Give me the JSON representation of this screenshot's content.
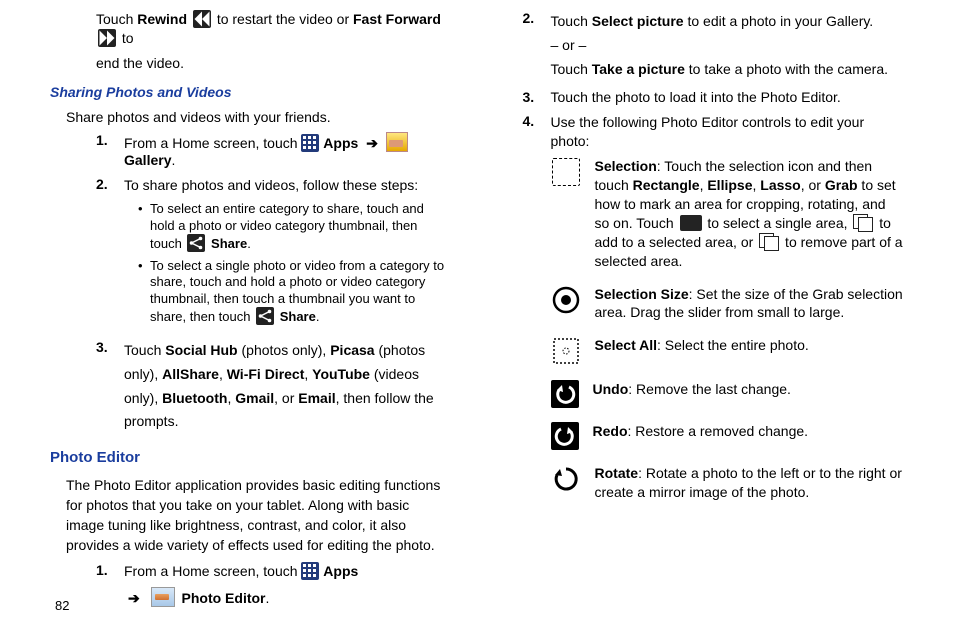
{
  "page_number": "82",
  "left": {
    "intro_line": {
      "pre": "Touch ",
      "rewind": "Rewind",
      "mid1": " to restart the video or ",
      "ff": "Fast Forward",
      "mid2": " to",
      "line2": "end the video."
    },
    "sharing_heading": "Sharing Photos and Videos",
    "sharing_intro": "Share photos and videos with your friends.",
    "step1": {
      "num": "1.",
      "pre": "From a Home screen, touch ",
      "apps": "Apps",
      "arrow": "➔",
      "gallery": "Gallery",
      "end": "."
    },
    "step2": {
      "num": "2.",
      "text": "To share photos and videos, follow these steps:",
      "bullet1_a": "To select an entire category to share, touch and hold a photo or video category thumbnail, then touch ",
      "bullet1_share": "Share",
      "bullet1_end": ".",
      "bullet2_a": "To select a single photo or video from a category to share, touch and hold a photo or video category thumbnail, then touch a thumbnail you want to share, then touch ",
      "bullet2_share": "Share",
      "bullet2_end": "."
    },
    "step3": {
      "num": "3.",
      "pre": "Touch ",
      "a1": "Social Hub",
      "t1": " (photos only), ",
      "a2": "Picasa",
      "t2": " (photos only), ",
      "a3": "AllShare",
      "c1": ", ",
      "a4": "Wi-Fi Direct",
      "c2": ", ",
      "a5": "YouTube",
      "t3": " (videos only), ",
      "a6": "Bluetooth",
      "c3": ", ",
      "a7": "Gmail",
      "t4": ", or ",
      "a8": "Email",
      "t5": ", then follow the prompts."
    },
    "pe_heading": "Photo Editor",
    "pe_intro": "The Photo Editor application provides basic editing functions for photos that you take on your tablet. Along with basic image tuning like brightness, contrast, and color, it also provides a wide variety of effects used for editing the photo.",
    "pe_step1": {
      "num": "1.",
      "pre": "From a Home screen, touch ",
      "apps": "Apps",
      "arrow": "➔",
      "pe": "Photo Editor",
      "end": "."
    }
  },
  "right": {
    "step2": {
      "num": "2.",
      "pre": "Touch ",
      "sp": "Select picture",
      "post": " to edit a photo in your Gallery.",
      "or": "– or –",
      "pre2": "Touch ",
      "tp": "Take a picture",
      "post2": " to take a photo with the camera."
    },
    "step3": {
      "num": "3.",
      "text": "Touch the photo to load it into the Photo Editor."
    },
    "step4": {
      "num": "4.",
      "text": "Use the following Photo Editor controls to edit your photo:",
      "tools": {
        "selection": {
          "label": "Selection",
          "a": ": Touch the selection icon and then touch ",
          "o1": "Rectangle",
          "c1": ", ",
          "o2": "Ellipse",
          "c2": ", ",
          "o3": "Lasso",
          "c3": ", or ",
          "o4": "Grab",
          "b": " to set how to mark an area for cropping, rotating, and so on. Touch ",
          "m1": " to select a single area, ",
          "m2": " to add to a selected area, or ",
          "m3": " to remove part of a selected area."
        },
        "selsize": {
          "label": "Selection Size",
          "text": ": Set the size of the Grab selection area. Drag the slider from small to large."
        },
        "selall": {
          "label": "Select All",
          "text": ": Select the entire photo."
        },
        "undo": {
          "label": "Undo",
          "text": ": Remove the last change."
        },
        "redo": {
          "label": "Redo",
          "text": ": Restore a removed change."
        },
        "rotate": {
          "label": "Rotate",
          "text": ": Rotate a photo to the left or to the right or create a mirror image of the photo."
        }
      }
    }
  }
}
